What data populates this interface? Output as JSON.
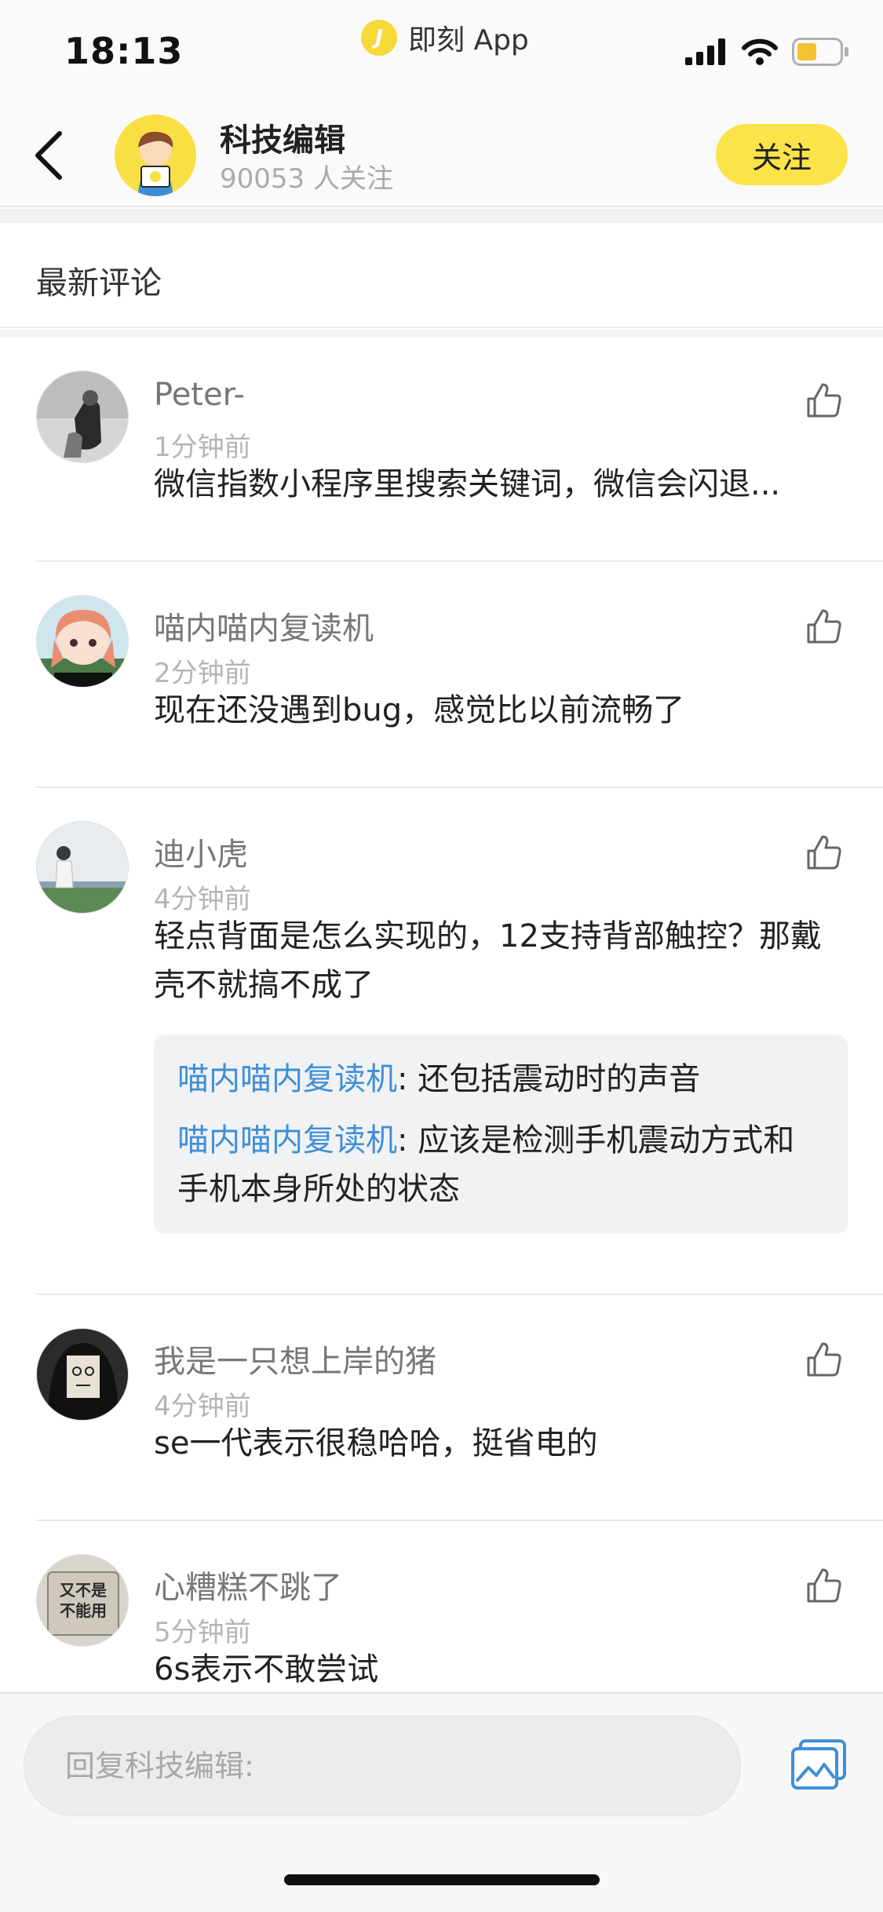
{
  "status_bar": {
    "time": "18:13",
    "app_name": "即刻 App",
    "app_badge_letter": "J"
  },
  "header": {
    "title": "科技编辑",
    "followers": "90053 人关注",
    "follow_label": "关注"
  },
  "section": {
    "title": "最新评论"
  },
  "comments": [
    {
      "username": "Peter-",
      "time": "1分钟前",
      "content": "微信指数小程序里搜索关键词，微信会闪退..."
    },
    {
      "username": "喵内喵内复读机",
      "time": "2分钟前",
      "content": "现在还没遇到bug，感觉比以前流畅了"
    },
    {
      "username": "迪小虎",
      "time": "4分钟前",
      "content": "轻点背面是怎么实现的，12支持背部触控？那戴壳不就搞不成了",
      "replies": [
        {
          "user": "喵内喵内复读机",
          "text": ": 还包括震动时的声音"
        },
        {
          "user": "喵内喵内复读机",
          "text": ": 应该是检测手机震动方式和手机本身所处的状态"
        }
      ]
    },
    {
      "username": "我是一只想上岸的猪",
      "time": "4分钟前",
      "content": "se一代表示很稳哈哈，挺省电的"
    },
    {
      "username": "心糟糕不跳了",
      "time": "5分钟前",
      "content": "6s表示不敢尝试",
      "avatar_text": [
        "又不是",
        "不能用"
      ]
    }
  ],
  "reply_bar": {
    "placeholder": "回复科技编辑:"
  },
  "colors": {
    "accent_yellow": "#fbe34a",
    "link_blue": "#3f8fd9"
  }
}
